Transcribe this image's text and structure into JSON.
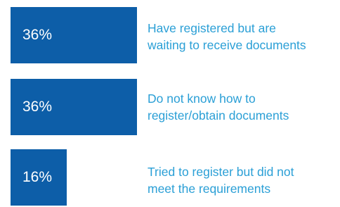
{
  "chart_data": {
    "type": "bar",
    "orientation": "horizontal",
    "values": [
      36,
      36,
      16
    ],
    "value_labels": [
      "36%",
      "36%",
      "16%"
    ],
    "categories": [
      [
        "Have registered but are",
        "waiting to receive documents"
      ],
      [
        "Do not know how to",
        "register/obtain documents"
      ],
      [
        "Tried to register but did not",
        "meet the requirements"
      ]
    ],
    "colors": {
      "bar": "#0d5ea8",
      "label": "#2a9fd6",
      "value_text": "#ffffff"
    }
  }
}
